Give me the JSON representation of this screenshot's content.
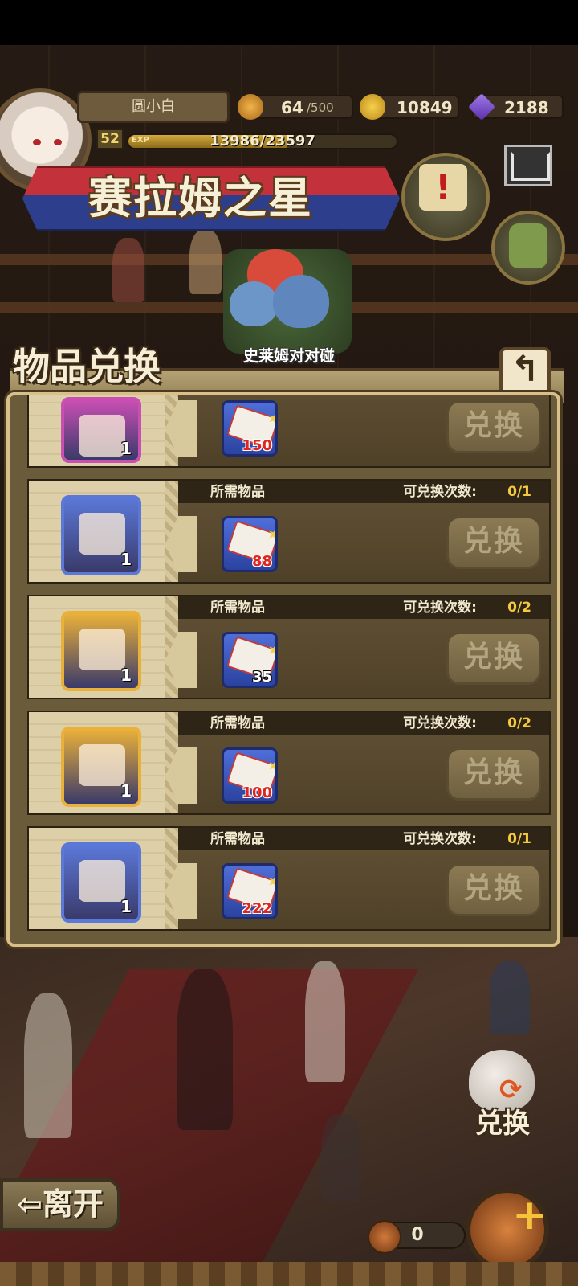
{
  "player": {
    "name": "圆小白",
    "level": "52",
    "exp_tag": "EXP",
    "exp_text": "13986/23597",
    "exp_fraction": 0.593
  },
  "resources": {
    "stamina": "64",
    "stamina_max": "/500",
    "gold": "10849",
    "gems": "2188"
  },
  "banner": {
    "title": "赛拉姆之星"
  },
  "event": {
    "label": "史莱姆对对碰"
  },
  "panel": {
    "title": "物品兑换",
    "back_icon": "back-arrow-icon",
    "header_required": "所需物品",
    "header_count_label": "可兑换次数:",
    "redeem_label": "兑换",
    "rows": [
      {
        "item": "pink-ticket-icon",
        "qty": "1",
        "cost": "150",
        "count": "",
        "slot_color": "#c94fb3"
      },
      {
        "item": "red-gift-box-icon",
        "qty": "1",
        "cost": "88",
        "count": "0/1",
        "slot_color": "#5b78d8"
      },
      {
        "item": "winged-lantern-icon",
        "qty": "1",
        "cost": "35",
        "count": "0/2",
        "slot_color": "#e9b03a"
      },
      {
        "item": "gold-ticket-icon",
        "qty": "1",
        "cost": "100",
        "count": "0/2",
        "slot_color": "#e9b03a"
      },
      {
        "item": "armored-figure-icon",
        "qty": "1",
        "cost": "222",
        "count": "0/1",
        "slot_color": "#5b78d8"
      }
    ]
  },
  "bottom": {
    "exchange_label": "兑换",
    "leave_label": "⇦离开",
    "coin_count": "0"
  },
  "colors": {
    "cost_red": "#e0241e",
    "count_yellow": "#f5c93d"
  }
}
